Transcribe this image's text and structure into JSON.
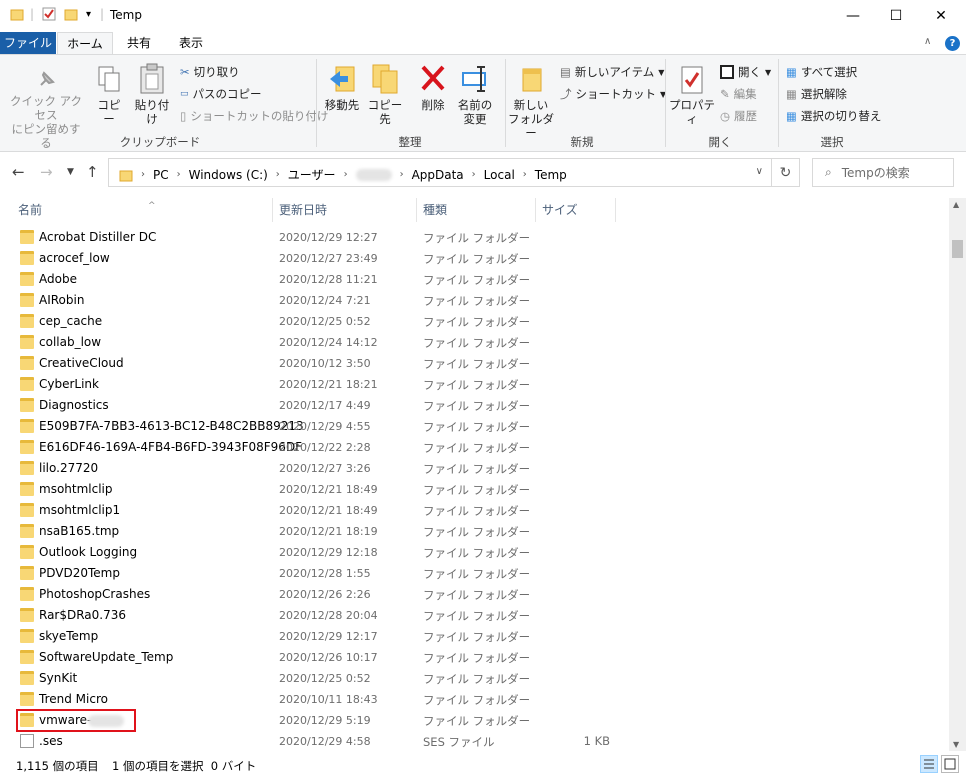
{
  "window": {
    "title": "Temp",
    "minimize": "—",
    "maximize": "☐",
    "close": "✕"
  },
  "ribbon_tabs": [
    {
      "label": "ファイル"
    },
    {
      "label": "ホーム"
    },
    {
      "label": "共有"
    },
    {
      "label": "表示"
    }
  ],
  "ribbon": {
    "pin_label": "クイック アクセス\nにピン留めする",
    "copy_label": "コピー",
    "paste_label": "貼り付け",
    "cut_label": "切り取り",
    "copy_path_label": "パスのコピー",
    "paste_shortcut_label": "ショートカットの貼り付け",
    "group_clipboard": "クリップボード",
    "move_to_label": "移動先",
    "copy_to_label": "コピー先",
    "delete_label": "削除",
    "rename_label": "名前の\n変更",
    "group_organize": "整理",
    "new_folder_label": "新しい\nフォルダー",
    "new_item_label": "新しいアイテム",
    "shortcut_label": "ショートカット",
    "group_new": "新規",
    "properties_label": "プロパティ",
    "open_label": "開く",
    "edit_label": "編集",
    "history_label": "履歴",
    "group_open": "開く",
    "select_all_label": "すべて選択",
    "select_none_label": "選択解除",
    "invert_selection_label": "選択の切り替え",
    "group_select": "選択"
  },
  "address": {
    "crumbs": [
      "PC",
      "Windows (C:)",
      "ユーザー",
      "",
      "AppData",
      "Local",
      "Temp"
    ],
    "search_placeholder": "Tempの検索"
  },
  "columns": {
    "name": "名前",
    "date": "更新日時",
    "type": "種類",
    "size": "サイズ"
  },
  "files": [
    {
      "name": "Acrobat Distiller DC",
      "date": "2020/12/29 12:27",
      "type": "ファイル フォルダー",
      "size": "",
      "icon": "folder-icon"
    },
    {
      "name": "acrocef_low",
      "date": "2020/12/27 23:49",
      "type": "ファイル フォルダー",
      "size": "",
      "icon": "folder-icon"
    },
    {
      "name": "Adobe",
      "date": "2020/12/28 11:21",
      "type": "ファイル フォルダー",
      "size": "",
      "icon": "folder-icon"
    },
    {
      "name": "AIRobin",
      "date": "2020/12/24 7:21",
      "type": "ファイル フォルダー",
      "size": "",
      "icon": "folder-icon"
    },
    {
      "name": "cep_cache",
      "date": "2020/12/25 0:52",
      "type": "ファイル フォルダー",
      "size": "",
      "icon": "folder-icon"
    },
    {
      "name": "collab_low",
      "date": "2020/12/24 14:12",
      "type": "ファイル フォルダー",
      "size": "",
      "icon": "folder-icon"
    },
    {
      "name": "CreativeCloud",
      "date": "2020/10/12 3:50",
      "type": "ファイル フォルダー",
      "size": "",
      "icon": "folder-icon"
    },
    {
      "name": "CyberLink",
      "date": "2020/12/21 18:21",
      "type": "ファイル フォルダー",
      "size": "",
      "icon": "folder-icon"
    },
    {
      "name": "Diagnostics",
      "date": "2020/12/17 4:49",
      "type": "ファイル フォルダー",
      "size": "",
      "icon": "folder-icon"
    },
    {
      "name": "E509B7FA-7BB3-4613-BC12-B48C2BB89213",
      "date": "2020/12/29 4:55",
      "type": "ファイル フォルダー",
      "size": "",
      "icon": "folder-icon"
    },
    {
      "name": "E616DF46-169A-4FB4-B6FD-3943F08F96DF",
      "date": "2020/12/22 2:28",
      "type": "ファイル フォルダー",
      "size": "",
      "icon": "folder-icon"
    },
    {
      "name": "lilo.27720",
      "date": "2020/12/27 3:26",
      "type": "ファイル フォルダー",
      "size": "",
      "icon": "folder-icon"
    },
    {
      "name": "msohtmlclip",
      "date": "2020/12/21 18:49",
      "type": "ファイル フォルダー",
      "size": "",
      "icon": "folder-icon"
    },
    {
      "name": "msohtmlclip1",
      "date": "2020/12/21 18:49",
      "type": "ファイル フォルダー",
      "size": "",
      "icon": "folder-icon"
    },
    {
      "name": "nsaB165.tmp",
      "date": "2020/12/21 18:19",
      "type": "ファイル フォルダー",
      "size": "",
      "icon": "folder-icon"
    },
    {
      "name": "Outlook Logging",
      "date": "2020/12/29 12:18",
      "type": "ファイル フォルダー",
      "size": "",
      "icon": "folder-icon"
    },
    {
      "name": "PDVD20Temp",
      "date": "2020/12/28 1:55",
      "type": "ファイル フォルダー",
      "size": "",
      "icon": "folder-icon"
    },
    {
      "name": "PhotoshopCrashes",
      "date": "2020/12/26 2:26",
      "type": "ファイル フォルダー",
      "size": "",
      "icon": "folder-icon"
    },
    {
      "name": "Rar$DRa0.736",
      "date": "2020/12/28 20:04",
      "type": "ファイル フォルダー",
      "size": "",
      "icon": "folder-icon"
    },
    {
      "name": "skyeTemp",
      "date": "2020/12/29 12:17",
      "type": "ファイル フォルダー",
      "size": "",
      "icon": "folder-icon"
    },
    {
      "name": "SoftwareUpdate_Temp",
      "date": "2020/12/26 10:17",
      "type": "ファイル フォルダー",
      "size": "",
      "icon": "folder-icon"
    },
    {
      "name": "SynKit",
      "date": "2020/12/25 0:52",
      "type": "ファイル フォルダー",
      "size": "",
      "icon": "folder-icon"
    },
    {
      "name": "Trend Micro",
      "date": "2020/10/11 18:43",
      "type": "ファイル フォルダー",
      "size": "",
      "icon": "folder-icon"
    },
    {
      "name": "vmware-",
      "date": "2020/12/29 5:19",
      "type": "ファイル フォルダー",
      "size": "",
      "icon": "folder-icon"
    },
    {
      "name": ".ses",
      "date": "2020/12/29 4:58",
      "type": "SES ファイル",
      "size": "1 KB",
      "icon": "file-icon"
    }
  ],
  "status": {
    "count": "1,115 個の項目",
    "selected": "1 個の項目を選択  0 バイト"
  },
  "colors": {
    "file_tab": "#1a5fa8",
    "highlight_box": "#e0121b",
    "folder": "#f8d775"
  }
}
